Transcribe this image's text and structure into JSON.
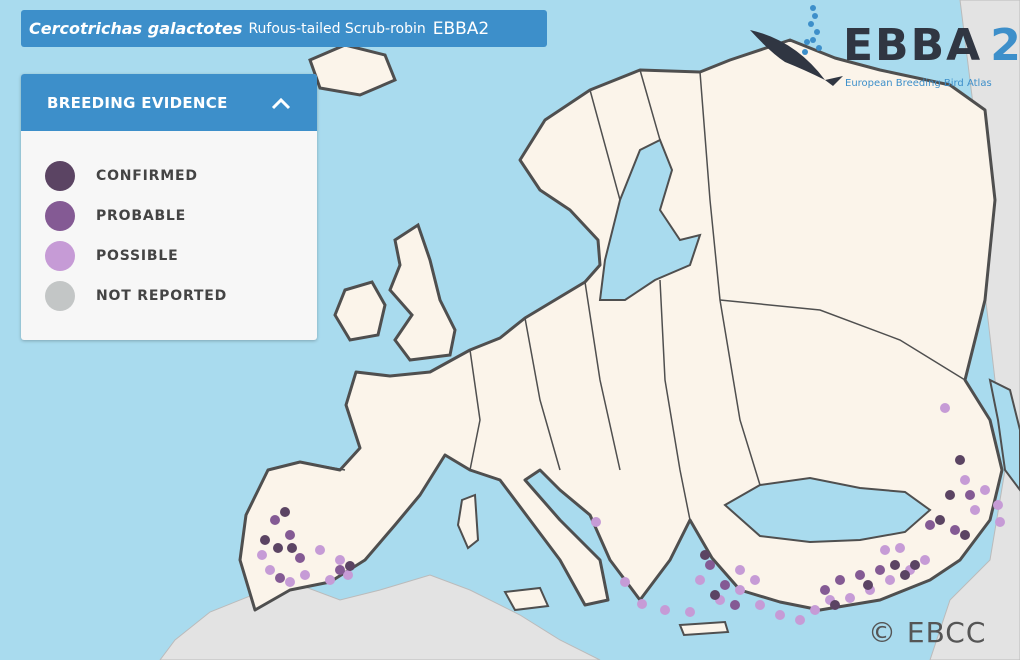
{
  "title": {
    "scientific_name": "Cercotrichas galactotes",
    "common_name": "Rufous-tailed Scrub-robin",
    "atlas": "EBBA2"
  },
  "legend": {
    "heading": "BREEDING EVIDENCE",
    "toggle_icon": "chevron-up-icon",
    "items": [
      {
        "label": "CONFIRMED",
        "color": "#5b4463"
      },
      {
        "label": "PROBABLE",
        "color": "#845a94"
      },
      {
        "label": "POSSIBLE",
        "color": "#c69bd6"
      },
      {
        "label": "NOT REPORTED",
        "color": "#c3c6c6"
      }
    ]
  },
  "logo": {
    "word": "EBBA",
    "number": "2",
    "tagline": "European Breeding Bird Atlas",
    "icon": "bird-logo-icon"
  },
  "copyright": "© EBCC",
  "colors": {
    "sea": "#a9dbee",
    "land": "#fbf4ea",
    "non_atlas_land": "#e3e3e3",
    "borders": "#555555",
    "accent": "#3d8fca"
  }
}
